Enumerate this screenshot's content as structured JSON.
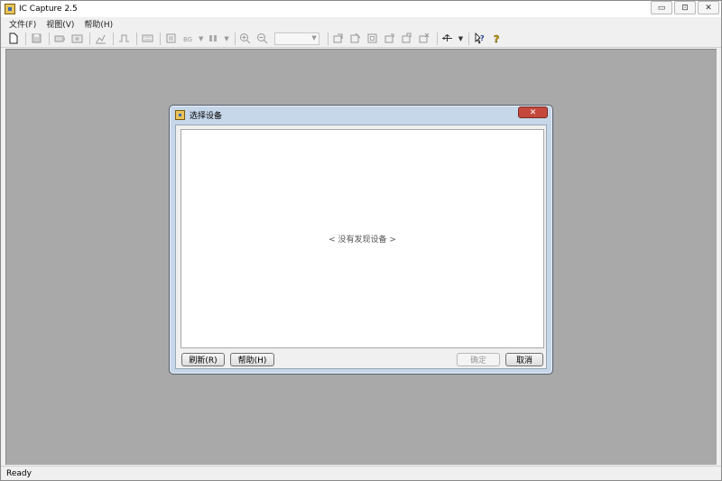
{
  "window": {
    "title": "IC Capture 2.5",
    "controls": {
      "minimize": "▭",
      "maximize": "⊡",
      "close": "✕"
    }
  },
  "menubar": {
    "items": [
      {
        "label": "文件(F)"
      },
      {
        "label": "视图(V)"
      },
      {
        "label": "帮助(H)"
      }
    ]
  },
  "toolbar": {
    "zoom_value": ""
  },
  "dialog": {
    "title": "选择设备",
    "close_label": "✕",
    "empty_message": "< 没有发现设备 >",
    "buttons": {
      "refresh": "刷新(R)",
      "help": "帮助(H)",
      "ok": "确定",
      "cancel": "取消"
    }
  },
  "statusbar": {
    "text": "Ready"
  }
}
